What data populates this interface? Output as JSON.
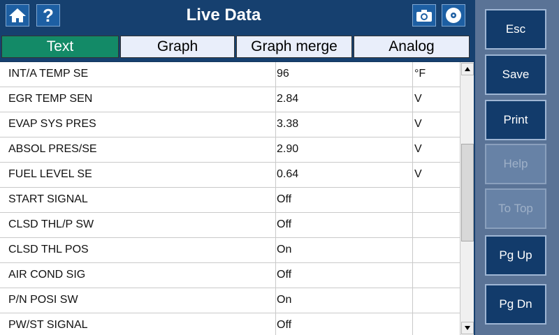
{
  "header": {
    "title": "Live Data",
    "help_label": "?"
  },
  "tabs": [
    {
      "label": "Text",
      "active": true
    },
    {
      "label": "Graph",
      "active": false
    },
    {
      "label": "Graph merge",
      "active": false
    },
    {
      "label": "Analog",
      "active": false
    }
  ],
  "rows": [
    {
      "name": "INT/A TEMP SE",
      "value": "96",
      "unit": "°F"
    },
    {
      "name": "EGR TEMP SEN",
      "value": "2.84",
      "unit": "V"
    },
    {
      "name": "EVAP SYS PRES",
      "value": "3.38",
      "unit": "V"
    },
    {
      "name": "ABSOL PRES/SE",
      "value": "2.90",
      "unit": "V"
    },
    {
      "name": "FUEL LEVEL SE",
      "value": "0.64",
      "unit": "V"
    },
    {
      "name": "START SIGNAL",
      "value": "Off",
      "unit": ""
    },
    {
      "name": "CLSD THL/P SW",
      "value": "Off",
      "unit": ""
    },
    {
      "name": "CLSD THL POS",
      "value": "On",
      "unit": ""
    },
    {
      "name": "AIR COND SIG",
      "value": "Off",
      "unit": ""
    },
    {
      "name": "P/N POSI SW",
      "value": "On",
      "unit": ""
    },
    {
      "name": "PW/ST SIGNAL",
      "value": "Off",
      "unit": ""
    }
  ],
  "scroll": {
    "position_fraction": 0.46,
    "visible_fraction": 0.4
  },
  "side_buttons": {
    "esc": {
      "label": "Esc",
      "enabled": true
    },
    "save": {
      "label": "Save",
      "enabled": true
    },
    "print": {
      "label": "Print",
      "enabled": true
    },
    "help": {
      "label": "Help",
      "enabled": false
    },
    "to_top": {
      "label": "To Top",
      "enabled": false
    },
    "pg_up": {
      "label": "Pg Up",
      "enabled": true
    },
    "pg_dn": {
      "label": "Pg Dn",
      "enabled": true
    }
  },
  "colors": {
    "header_bg": "#16406f",
    "active_tab": "#138a67",
    "side_panel": "#5a7396",
    "side_button": "#123b6b"
  },
  "icons": [
    "home-icon",
    "help-icon",
    "camera-icon",
    "record-disc-icon",
    "scroll-up-arrow-icon",
    "scroll-down-arrow-icon"
  ]
}
